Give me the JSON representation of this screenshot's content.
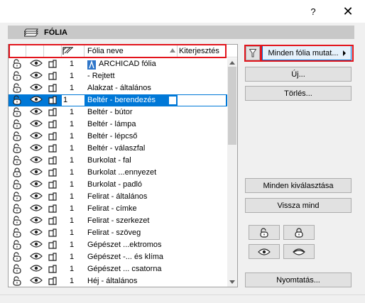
{
  "titlebar": {
    "help_label": "?",
    "close_label": "✕"
  },
  "panel": {
    "title": "FÓLIA"
  },
  "table": {
    "columns": {
      "name": "Fólia neve",
      "extension": "Kiterjesztés"
    },
    "selected_index": 3,
    "rows": [
      {
        "lock": "unlocked",
        "visible": true,
        "wire": "solid",
        "num": "1",
        "name": "ARCHICAD fólia",
        "archicad_icon": true
      },
      {
        "lock": "unlocked",
        "visible": true,
        "wire": "solid",
        "num": "1",
        "name": "- Rejtett"
      },
      {
        "lock": "unlocked",
        "visible": true,
        "wire": "solid",
        "num": "1",
        "name": "Alakzat - általános"
      },
      {
        "lock": "unlocked",
        "visible": true,
        "wire": "solid",
        "num": "1",
        "name": "Beltér - berendezés"
      },
      {
        "lock": "unlocked",
        "visible": true,
        "wire": "solid",
        "num": "1",
        "name": "Beltér - bútor"
      },
      {
        "lock": "unlocked",
        "visible": true,
        "wire": "solid",
        "num": "1",
        "name": "Beltér - lámpa"
      },
      {
        "lock": "unlocked",
        "visible": true,
        "wire": "solid",
        "num": "1",
        "name": "Beltér - lépcső"
      },
      {
        "lock": "unlocked",
        "visible": true,
        "wire": "solid",
        "num": "1",
        "name": "Beltér - válaszfal"
      },
      {
        "lock": "unlocked",
        "visible": true,
        "wire": "solid",
        "num": "1",
        "name": "Burkolat - fal"
      },
      {
        "lock": "locked",
        "visible": true,
        "wire": "solid",
        "num": "1",
        "name": "Burkolat ...ennyezet"
      },
      {
        "lock": "unlocked",
        "visible": true,
        "wire": "solid",
        "num": "1",
        "name": "Burkolat - padló"
      },
      {
        "lock": "unlocked",
        "visible": true,
        "wire": "solid",
        "num": "1",
        "name": "Felirat - általános"
      },
      {
        "lock": "unlocked",
        "visible": true,
        "wire": "solid",
        "num": "1",
        "name": "Felirat - címke"
      },
      {
        "lock": "unlocked",
        "visible": true,
        "wire": "solid",
        "num": "1",
        "name": "Felirat - szerkezet"
      },
      {
        "lock": "unlocked",
        "visible": true,
        "wire": "solid",
        "num": "1",
        "name": "Felirat - szöveg"
      },
      {
        "lock": "unlocked",
        "visible": true,
        "wire": "solid",
        "num": "1",
        "name": "Gépészet ...ektromos"
      },
      {
        "lock": "unlocked",
        "visible": true,
        "wire": "solid",
        "num": "1",
        "name": "Gépészet -... és klíma"
      },
      {
        "lock": "unlocked",
        "visible": true,
        "wire": "solid",
        "num": "1",
        "name": "Gépészet ... csatorna"
      },
      {
        "lock": "unlocked",
        "visible": true,
        "wire": "solid",
        "num": "1",
        "name": "Héj - általános"
      }
    ]
  },
  "buttons": {
    "show_all": "Minden fólia mutat...",
    "new": "Új...",
    "delete": "Törlés...",
    "select_all": "Minden kiválasztása",
    "undo_all": "Vissza mind",
    "print": "Nyomtatás..."
  },
  "colors": {
    "highlight": "#e2141c",
    "selection": "#0078d7"
  }
}
